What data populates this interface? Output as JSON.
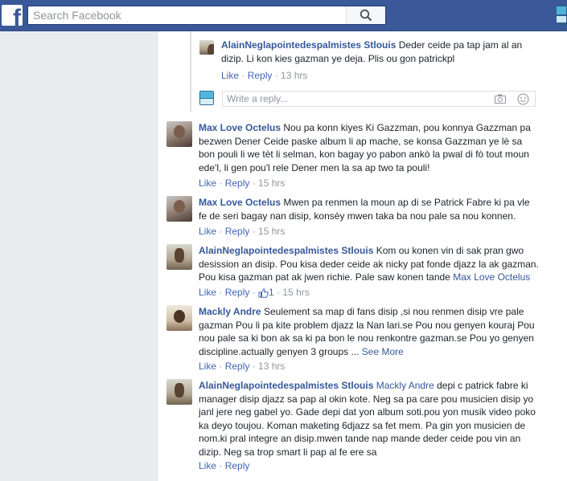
{
  "search": {
    "placeholder": "Search Facebook"
  },
  "reply_box": {
    "placeholder": "Write a reply..."
  },
  "comments": [
    {
      "author": "AlainNeglapointedespalmistes Stlouis",
      "text": "Deder ceide pa tap jam al an dizip. Li kon kies gazman ye deja. Plis ou gon patrickpl",
      "like": "Like",
      "reply": "Reply",
      "time": "13 hrs"
    },
    {
      "author": "Max Love Octelus",
      "text": "Nou pa konn kiyes Ki Gazzman, pou konnya Gazzman pa bezwen Dener Ceide paske album li ap mache, se konsa Gazzman ye lè sa bon pouli li we tèt li selman, kon bagay yo pabon ankò la pwal di fò tout moun ede'l, li gen pou'l rele Dener men la sa ap two ta pouli!",
      "like": "Like",
      "reply": "Reply",
      "time": "15 hrs"
    },
    {
      "author": "Max Love Octelus",
      "text": "Mwen pa renmen la moun ap di se Patrick Fabre ki pa vle fe de seri bagay nan disip, konsèy mwen taka ba nou pale sa nou konnen.",
      "like": "Like",
      "reply": "Reply",
      "time": "15 hrs"
    },
    {
      "author": "AlainNeglapointedespalmistes Stlouis",
      "text": "Kom ou konen vin di sak pran gwo desission an disip. Pou kisa deder ceide ak nicky pat fonde djazz la ak gazman. Pou kisa gazman pat ak jwen richie. Pale saw konen tande",
      "mention": "Max Love Octelus",
      "like": "Like",
      "reply": "Reply",
      "likes": "1",
      "time": "15 hrs"
    },
    {
      "author": "Mackly Andre",
      "text": "Seulement sa map di fans disip ,si nou renmen disip vre pale gazman Pou li pa kite problem djazz la Nan lari.se Pou nou genyen kouraj Pou nou pale sa ki bon ak sa ki pa bon le nou renkontre gazman.se Pou yo genyen discipline.actually genyen 3 groups ...",
      "see_more": "See More",
      "like": "Like",
      "reply": "Reply",
      "time": "13 hrs"
    },
    {
      "author": "AlainNeglapointedespalmistes Stlouis",
      "mention": "Mackly Andre",
      "text": "depi c patrick fabre ki manager disip djazz sa pap al okin kote. Neg sa pa care pou musicien disip yo janl jere neg gabel yo. Gade depi dat yon album soti.pou yon musik video poko ka deyo toujou. Koman maketing 6djazz sa fet mem. Pa gin yon musicien de nom.ki pral integre an disip.mwen tande nap mande deder ceide pou vin an dizip. Neg sa trop smart li pap al fe ere sa",
      "like": "Like",
      "reply": "Reply"
    }
  ],
  "separator": " · ",
  "colors": {
    "topbar": "#3b5998",
    "link": "#365899",
    "action": "#4267b2",
    "meta": "#90949c"
  }
}
